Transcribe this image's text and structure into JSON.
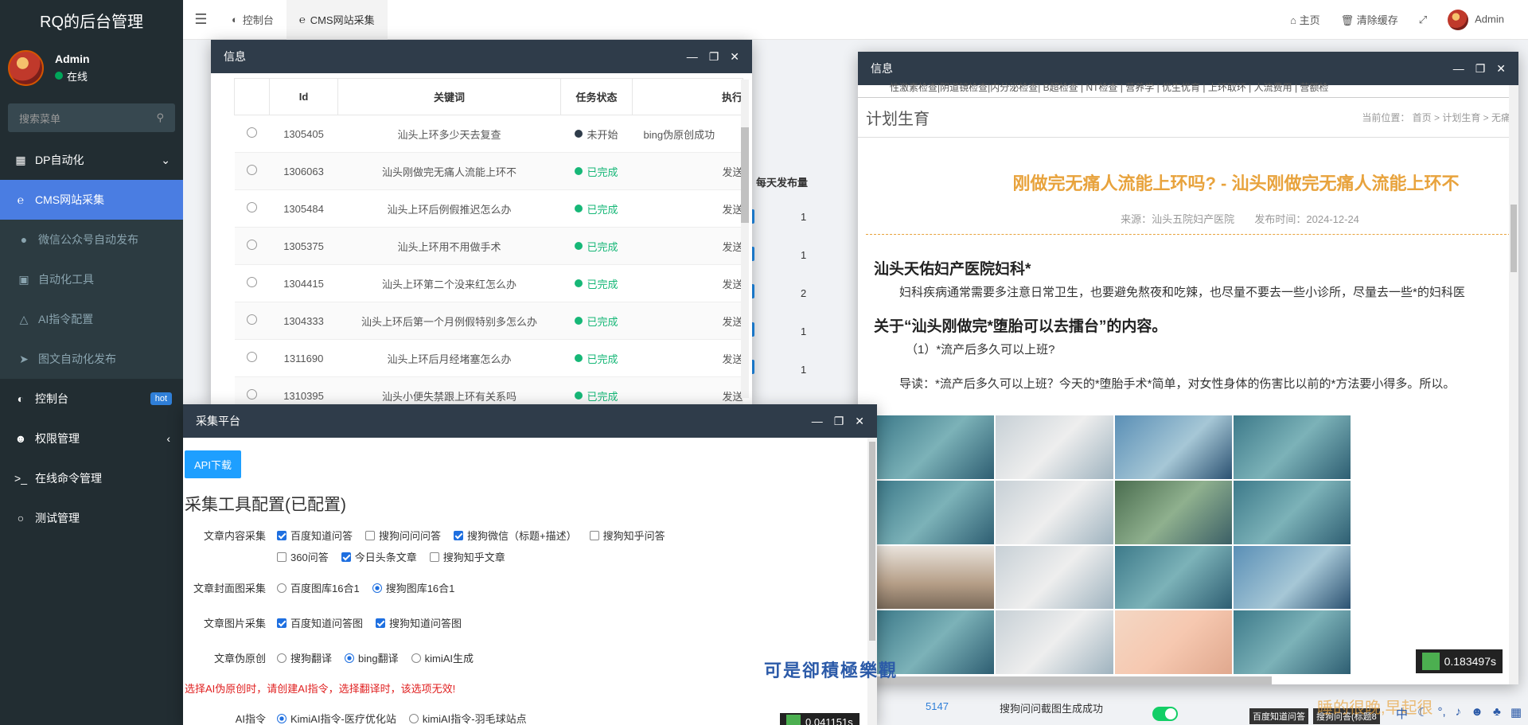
{
  "app": {
    "title": "RQ的后台管理"
  },
  "user": {
    "name": "Admin",
    "status": "在线"
  },
  "sidebar": {
    "search_placeholder": "搜索菜单",
    "items": [
      {
        "label": "DP自动化",
        "icon": "windows-icon"
      },
      {
        "label": "CMS网站采集",
        "icon": "ie-icon"
      },
      {
        "label": "微信公众号自动发布",
        "icon": "wechat-icon"
      },
      {
        "label": "自动化工具",
        "icon": "briefcase-icon"
      },
      {
        "label": "AI指令配置",
        "icon": "flask-icon"
      },
      {
        "label": "图文自动化发布",
        "icon": "plane-icon"
      },
      {
        "label": "控制台",
        "icon": "dashboard-icon",
        "badge": "hot"
      },
      {
        "label": "权限管理",
        "icon": "users-icon"
      },
      {
        "label": "在线命令管理",
        "icon": "terminal-icon"
      },
      {
        "label": "测试管理",
        "icon": "circle-icon"
      }
    ]
  },
  "topbar": {
    "tabs": [
      {
        "label": "控制台"
      },
      {
        "label": "CMS网站采集"
      }
    ],
    "home": "主页",
    "clear_cache": "清除缓存",
    "user": "Admin"
  },
  "background": {
    "headers": [
      "每天发布量"
    ],
    "daily_values": [
      "1",
      "1",
      "2",
      "1",
      "1"
    ],
    "bottom_id": "5147",
    "bottom_text": "搜狗问问截图生成成功",
    "chip1": "百度知道问答",
    "chip2": "搜狗问答(标题8"
  },
  "window_tasks": {
    "title": "信息",
    "columns": [
      "Id",
      "关键词",
      "任务状态",
      "执行"
    ],
    "rows": [
      {
        "id": "1305405",
        "keyword": "汕头上环多少天去复查",
        "status": "未开始",
        "exec": "bing伪原创成功"
      },
      {
        "id": "1306063",
        "keyword": "汕头刚做完无痛人流能上环不",
        "status": "已完成",
        "exec": "发送"
      },
      {
        "id": "1305484",
        "keyword": "汕头上环后例假推迟怎么办",
        "status": "已完成",
        "exec": "发送"
      },
      {
        "id": "1305375",
        "keyword": "汕头上环用不用做手术",
        "status": "已完成",
        "exec": "发送"
      },
      {
        "id": "1304415",
        "keyword": "汕头上环第二个没来红怎么办",
        "status": "已完成",
        "exec": "发送"
      },
      {
        "id": "1304333",
        "keyword": "汕头上环后第一个月例假特别多怎么办",
        "status": "已完成",
        "exec": "发送"
      },
      {
        "id": "1311690",
        "keyword": "汕头上环后月经堵塞怎么办",
        "status": "已完成",
        "exec": "发送"
      },
      {
        "id": "1310395",
        "keyword": "汕头小便失禁跟上环有关系吗",
        "status": "已完成",
        "exec": "发送"
      }
    ]
  },
  "window_article": {
    "title": "信息",
    "nav": "性激素检查|阴道镜检查|内分泌检查|   B超检查 | NT检查 | 营养学 |   优生优育 | 上环取环 | 人流费用 |   营额检",
    "section": "计划生育",
    "breadcrumb": "当前位置： 首页 > 计划生育 > 无痛",
    "article_title": "刚做完无痛人流能上环吗? - 汕头刚做完无痛人流能上环不",
    "source": "来源：汕头五院妇产医院",
    "date": "发布时间：2024-12-24",
    "h1": "汕头天佑妇产医院妇科*",
    "p1": "妇科疾病通常需要多注意日常卫生，也要避免熬夜和吃辣，也尽量不要去一些小诊所，尽量去一些*的妇科医",
    "h2": "关于“汕头刚做完*堕胎可以去擂台”的内容。",
    "p2": "（1）*流产后多久可以上班?",
    "p3": "导读：*流产后多久可以上班？今天的*堕胎手术*简单，对女性身体的伤害比以前的*方法要小得多。所以。",
    "timer": "0.183497s"
  },
  "window_collect": {
    "title": "采集平台",
    "api_button": "API下载",
    "config_title": "采集工具配置(已配置)",
    "rows": [
      {
        "label": "文章内容采集",
        "options": [
          {
            "text": "百度知道问答",
            "on": true
          },
          {
            "text": "搜狗问问问答",
            "on": false
          },
          {
            "text": "搜狗微信（标题+描述）",
            "on": true
          },
          {
            "text": "搜狗知乎问答",
            "on": false
          },
          {
            "text": "360问答",
            "on": false
          },
          {
            "text": "今日头条文章",
            "on": true
          },
          {
            "text": "搜狗知乎文章",
            "on": false
          }
        ]
      },
      {
        "label": "文章封面图采集",
        "options": [
          {
            "text": "百度图库16合1",
            "on": false
          },
          {
            "text": "搜狗图库16合1",
            "on": true
          }
        ]
      },
      {
        "label": "文章图片采集",
        "options": [
          {
            "text": "百度知道问答图",
            "on": true
          },
          {
            "text": "搜狗知道问答图",
            "on": true
          }
        ]
      },
      {
        "label": "文章伪原创",
        "options": [
          {
            "text": "搜狗翻译",
            "on": false
          },
          {
            "text": "bing翻译",
            "on": true
          },
          {
            "text": "kimiAI生成",
            "on": false
          }
        ]
      },
      {
        "label": "AI指令",
        "options": [
          {
            "text": "KimiAI指令-医疗优化站",
            "on": true
          },
          {
            "text": "kimiAI指令-羽毛球站点",
            "on": false
          }
        ]
      }
    ],
    "warning": "选择AI伪原创时，请创建AI指令，选择翻译时，该选项无效!",
    "timer": "0.041151s"
  },
  "watermark": "可是卻積極樂觀",
  "watermark2": "睡的很晚,早起很"
}
